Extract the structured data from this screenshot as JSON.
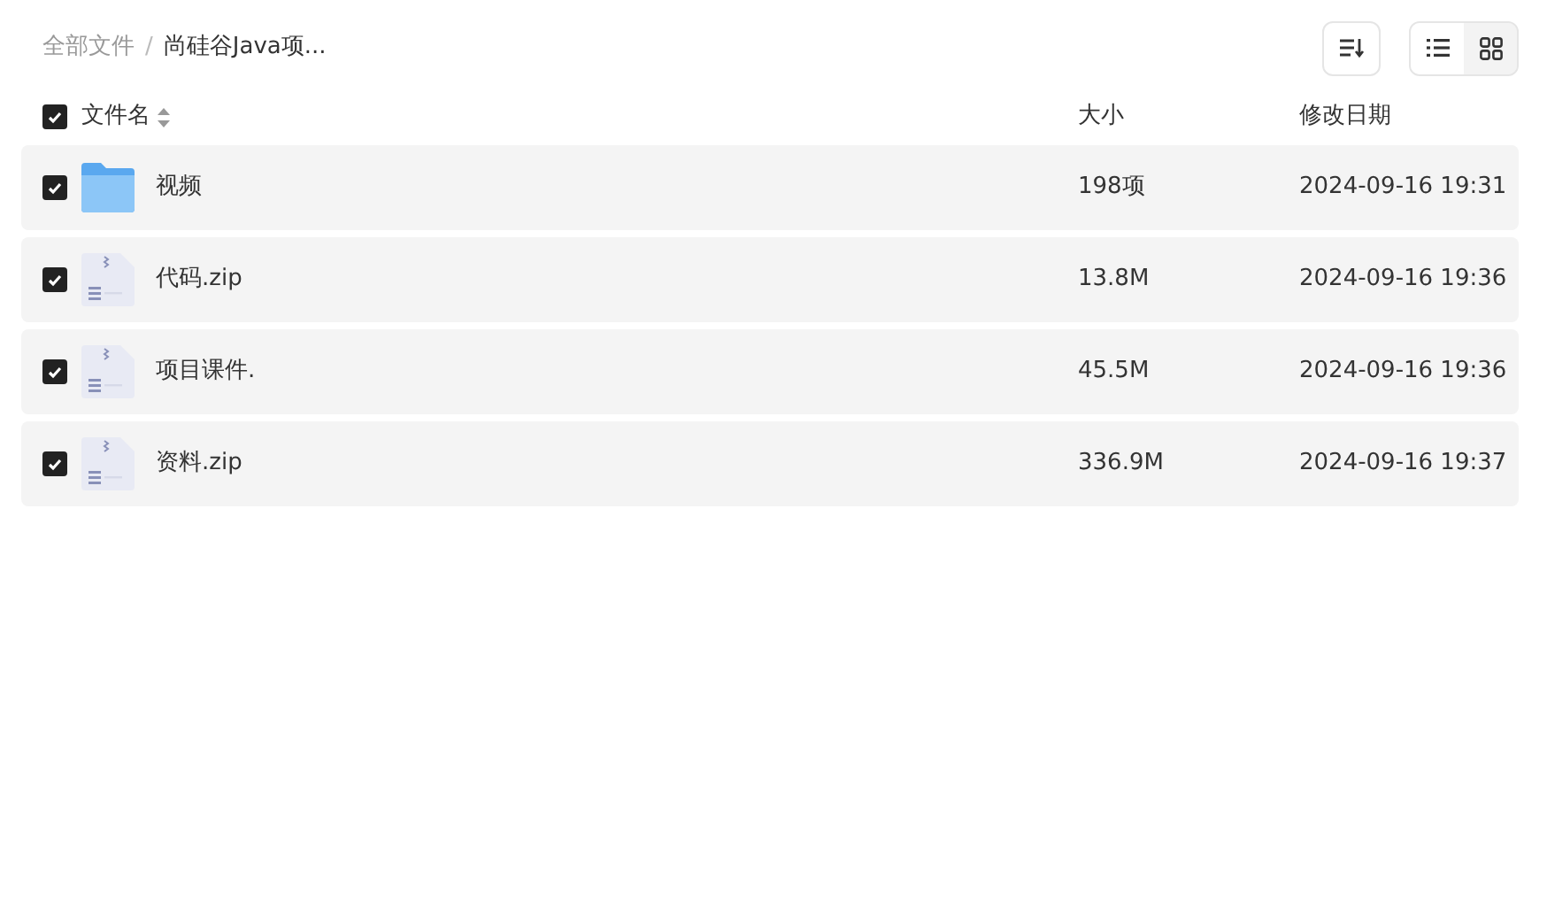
{
  "breadcrumb_separator": "/",
  "breadcrumb": [
    {
      "label": "全部文件",
      "current": false
    },
    {
      "label": "尚硅谷Java项...",
      "current": true
    }
  ],
  "view_modes": [
    {
      "kind": "list",
      "selected": true
    },
    {
      "kind": "grid",
      "selected": false
    }
  ],
  "table": {
    "select_all": {
      "checked": true
    },
    "columns": [
      "文件名",
      "大小",
      "修改日期"
    ],
    "rows": [
      {
        "kind": "folder",
        "checked": true,
        "name": "视频",
        "size": "198项",
        "date": "2024-09-16 19:31"
      },
      {
        "kind": "zip",
        "checked": true,
        "name": "代码.zip",
        "size": "13.8M",
        "date": "2024-09-16 19:36"
      },
      {
        "kind": "zip",
        "checked": true,
        "name": "项目课件.",
        "size": "45.5M",
        "date": "2024-09-16 19:36"
      },
      {
        "kind": "zip",
        "checked": true,
        "name": "资料.zip",
        "size": "336.9M",
        "date": "2024-09-16 19:37"
      }
    ]
  }
}
